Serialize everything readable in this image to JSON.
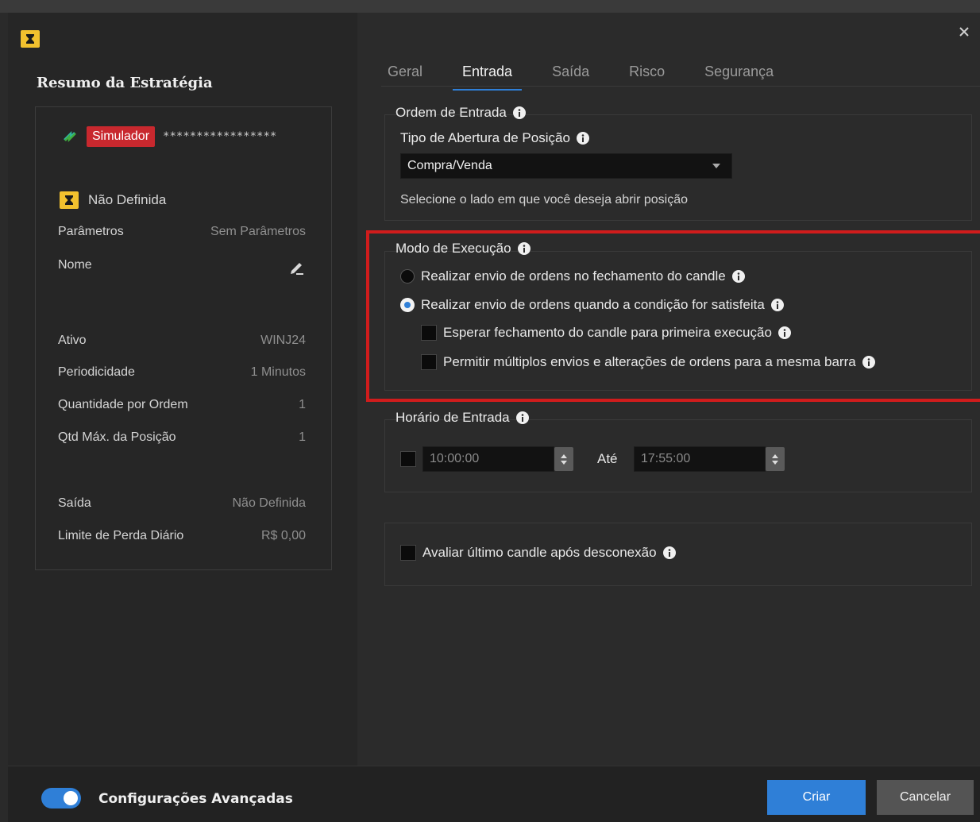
{
  "colors": {
    "accent": "#2f7fd7",
    "simulator_badge": "#c8282e",
    "highlight_border": "#d01c1c",
    "brand_yellow": "#f2c12e"
  },
  "icons": {
    "app_logo": "hourglass-logo-icon",
    "close": "close-icon",
    "info": "info-icon",
    "connection": "arrows-icon",
    "edit": "pencil-icon"
  },
  "summary": {
    "title": "Resumo da Estratégia",
    "simulator_badge": "Simulador",
    "masked_account": "*****************",
    "strategy_label": "Não Definida",
    "rows": [
      {
        "key": "Parâmetros",
        "value": "Sem Parâmetros"
      },
      {
        "key": "Nome",
        "value": ""
      },
      {
        "key": "Ativo",
        "value": "WINJ24"
      },
      {
        "key": "Periodicidade",
        "value": "1 Minutos"
      },
      {
        "key": "Quantidade por Ordem",
        "value": "1"
      },
      {
        "key": "Qtd Máx. da Posição",
        "value": "1"
      },
      {
        "key": "Saída",
        "value": "Não Definida"
      },
      {
        "key": "Limite de Perda Diário",
        "value": "R$ 0,00"
      }
    ]
  },
  "tabs": [
    {
      "label": "Geral",
      "active": false
    },
    {
      "label": "Entrada",
      "active": true
    },
    {
      "label": "Saída",
      "active": false
    },
    {
      "label": "Risco",
      "active": false
    },
    {
      "label": "Segurança",
      "active": false
    }
  ],
  "entry_order": {
    "title": "Ordem de Entrada",
    "position_type_label": "Tipo de Abertura de Posição",
    "position_type_value": "Compra/Venda",
    "hint": "Selecione o lado em que você deseja abrir posição"
  },
  "execution_mode": {
    "title": "Modo de Execução",
    "options": [
      {
        "label": "Realizar envio de ordens no fechamento do candle",
        "selected": false
      },
      {
        "label": "Realizar envio de ordens quando a condição for satisfeita",
        "selected": true
      }
    ],
    "checkboxes": [
      {
        "label": "Esperar fechamento do candle para primeira execução",
        "checked": false
      },
      {
        "label": "Permitir múltiplos envios e alterações de ordens para a mesma barra",
        "checked": false
      }
    ]
  },
  "entry_time": {
    "title": "Horário de Entrada",
    "enabled": false,
    "start": "10:00:00",
    "to_label": "Até",
    "end": "17:55:00"
  },
  "reconnect": {
    "label": "Avaliar último candle após desconexão",
    "checked": false
  },
  "footer": {
    "advanced_toggle_label": "Configurações Avançadas",
    "advanced_enabled": true,
    "create_label": "Criar",
    "cancel_label": "Cancelar"
  }
}
